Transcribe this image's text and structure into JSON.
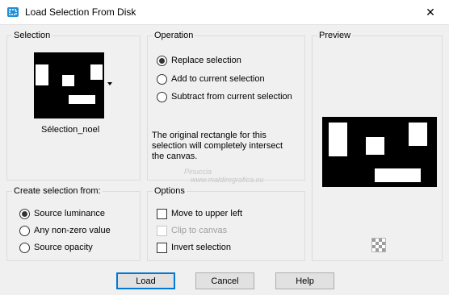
{
  "window": {
    "title": "Load Selection From Disk",
    "close_glyph": "✕",
    "icon": "selection-app-icon"
  },
  "selection": {
    "label": "Selection",
    "file_name": "Sélection_noel"
  },
  "operation": {
    "label": "Operation",
    "options": [
      {
        "label": "Replace selection",
        "checked": true
      },
      {
        "label": "Add to current selection",
        "checked": false
      },
      {
        "label": "Subtract from current selection",
        "checked": false
      }
    ],
    "info_lines": [
      "The original rectangle for this",
      "selection will completely intersect",
      "the canvas."
    ]
  },
  "preview": {
    "label": "Preview",
    "watermark_line1": "Pinuccia",
    "watermark_line2": "www.maldiregrafica.eu"
  },
  "create_from": {
    "label": "Create selection from:",
    "options": [
      {
        "label": "Source luminance",
        "checked": true
      },
      {
        "label": "Any non-zero value",
        "checked": false
      },
      {
        "label": "Source opacity",
        "checked": false
      }
    ]
  },
  "options": {
    "label": "Options",
    "items": [
      {
        "label": "Move to upper left",
        "checked": false,
        "enabled": true
      },
      {
        "label": "Clip to canvas",
        "checked": false,
        "enabled": false
      },
      {
        "label": "Invert selection",
        "checked": false,
        "enabled": true
      }
    ]
  },
  "buttons": {
    "load": "Load",
    "cancel": "Cancel",
    "help": "Help"
  },
  "colors": {
    "accent": "#0078d7",
    "app_icon": "#1e8fd6"
  }
}
